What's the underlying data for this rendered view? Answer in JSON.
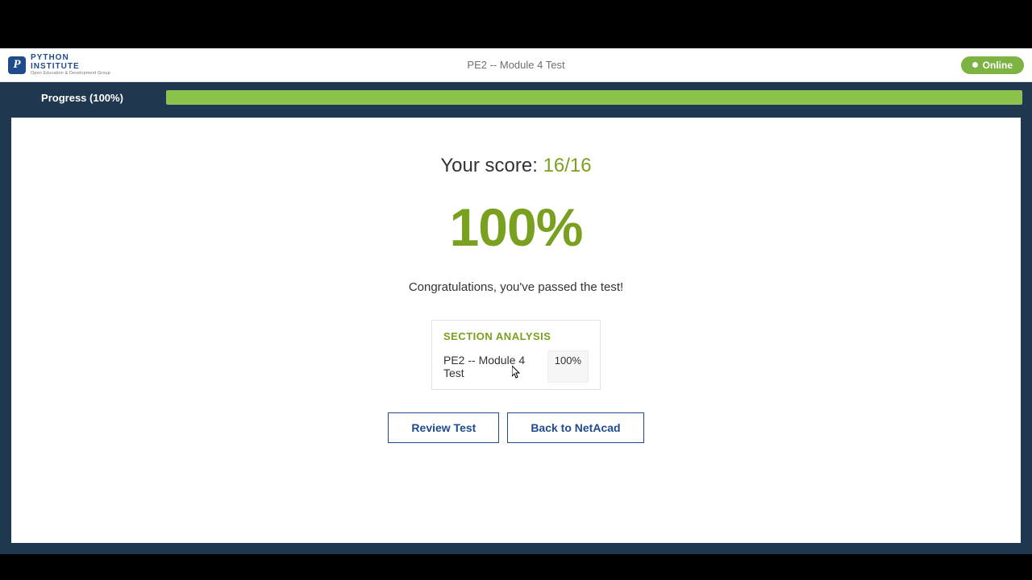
{
  "header": {
    "logo_line1": "PYTHON",
    "logo_line2": "INSTITUTE",
    "logo_sub": "Open Education & Development Group",
    "title": "PE2 -- Module 4 Test",
    "status_label": "Online"
  },
  "progress": {
    "label": "Progress (100%)",
    "percent": 100
  },
  "result": {
    "score_prefix": "Your score: ",
    "score_value": "16/16",
    "percent": "100%",
    "message": "Congratulations, you've passed the test!"
  },
  "section": {
    "title": "SECTION ANALYSIS",
    "rows": [
      {
        "name": "PE2 -- Module 4 Test",
        "pct": "100%"
      }
    ]
  },
  "buttons": {
    "review": "Review Test",
    "back": "Back to NetAcad"
  },
  "colors": {
    "accent_green": "#7aa01f",
    "brand_blue": "#1f4b8c",
    "panel_navy": "#1f374f"
  }
}
